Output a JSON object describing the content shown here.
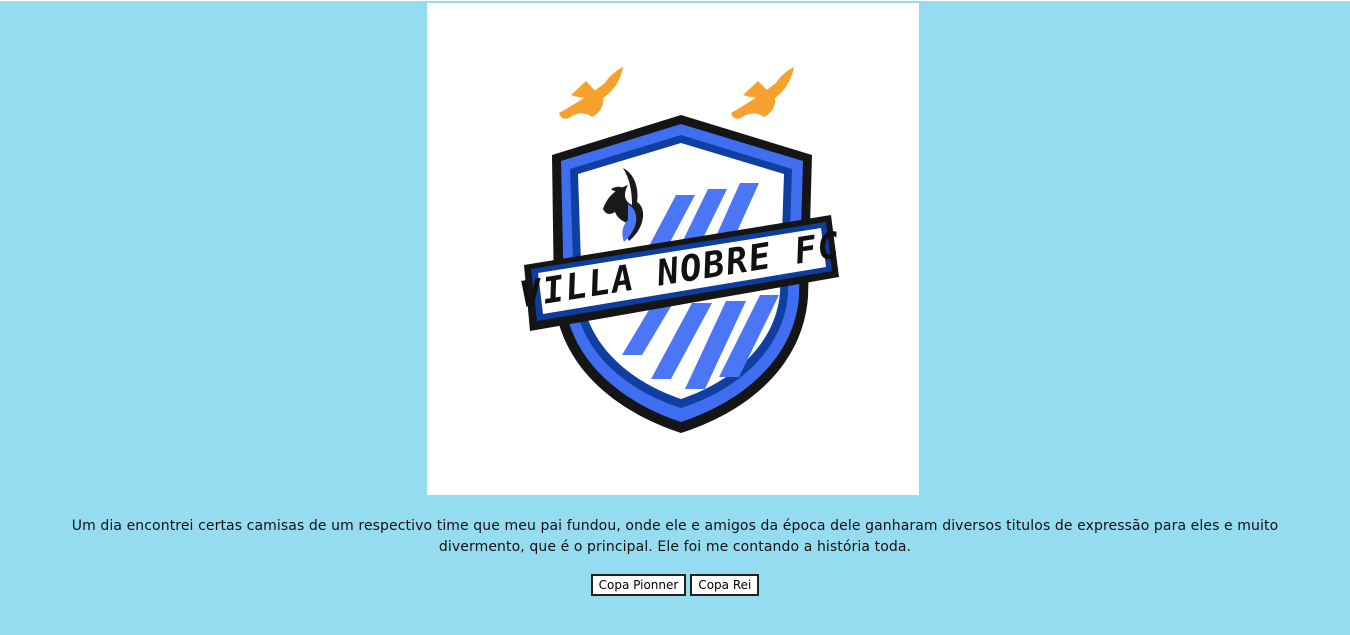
{
  "logo": {
    "text": "VILLA NOBRE FC",
    "icon": "team-crest-icon",
    "colors": {
      "shield_outer": "#151515",
      "shield_blue": "#3f6ff0",
      "shield_dark_blue": "#1347a8",
      "stripe_blue": "#4b76f5",
      "bird_orange": "#f6a12d",
      "banner_border": "#0d3e9c",
      "background": "#ffffff"
    }
  },
  "story": {
    "text": "Um dia encontrei certas camisas de um respectivo time que meu pai fundou, onde ele e amigos da época dele ganharam diversos titulos de expressão para eles e muito divermento, que é o principal. Ele foi me contando a história toda."
  },
  "buttons": [
    {
      "label": "Copa Pionner"
    },
    {
      "label": "Copa Rei"
    }
  ],
  "page": {
    "background": "#96dcf1"
  }
}
